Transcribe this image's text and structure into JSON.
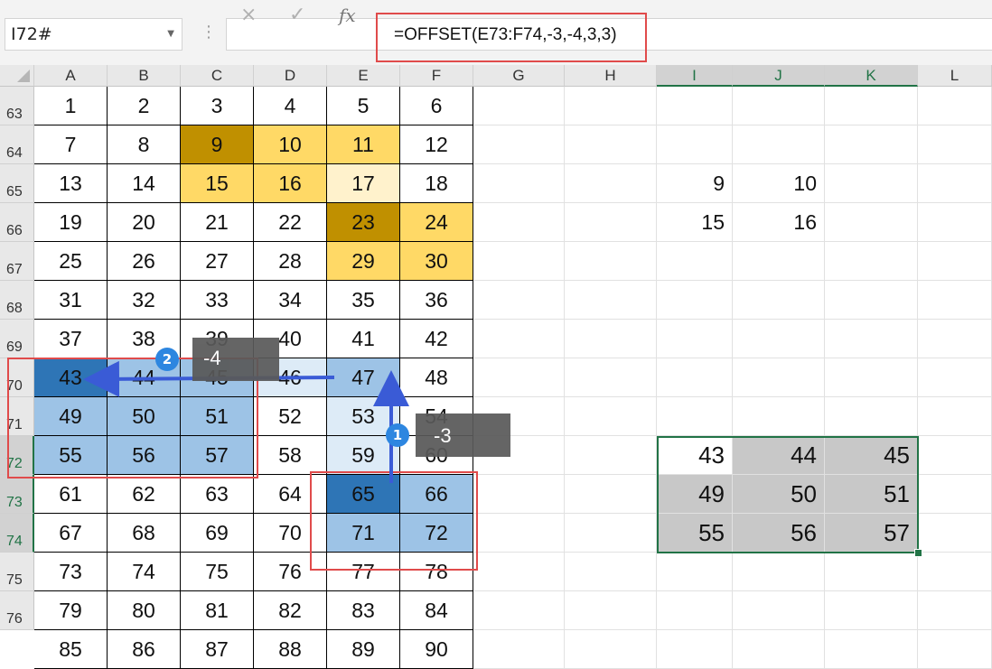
{
  "name_box": "I72#",
  "formula": "=OFFSET(E73:F74,-3,-4,3,3)",
  "toolbar": {
    "cancel_icon": "×",
    "confirm_icon": "✓",
    "fx_icon": "fx"
  },
  "columns": [
    "A",
    "B",
    "C",
    "D",
    "E",
    "F",
    "G",
    "H",
    "I",
    "J",
    "K",
    "L"
  ],
  "rows": [
    "63",
    "64",
    "65",
    "66",
    "67",
    "68",
    "69",
    "70",
    "71",
    "72",
    "73",
    "74",
    "75",
    "76"
  ],
  "grid_values": [
    [
      "1",
      "2",
      "3",
      "4",
      "5",
      "6"
    ],
    [
      "7",
      "8",
      "9",
      "10",
      "11",
      "12"
    ],
    [
      "13",
      "14",
      "15",
      "16",
      "17",
      "18"
    ],
    [
      "19",
      "20",
      "21",
      "22",
      "23",
      "24"
    ],
    [
      "25",
      "26",
      "27",
      "28",
      "29",
      "30"
    ],
    [
      "31",
      "32",
      "33",
      "34",
      "35",
      "36"
    ],
    [
      "37",
      "38",
      "39",
      "40",
      "41",
      "42"
    ],
    [
      "43",
      "44",
      "45",
      "46",
      "47",
      "48"
    ],
    [
      "49",
      "50",
      "51",
      "52",
      "53",
      "54"
    ],
    [
      "55",
      "56",
      "57",
      "58",
      "59",
      "60"
    ],
    [
      "61",
      "62",
      "63",
      "64",
      "65",
      "66"
    ],
    [
      "67",
      "68",
      "69",
      "70",
      "71",
      "72"
    ],
    [
      "73",
      "74",
      "75",
      "76",
      "77",
      "78"
    ],
    [
      "79",
      "80",
      "81",
      "82",
      "83",
      "84"
    ],
    [
      "85",
      "86",
      "87",
      "88",
      "89",
      "90"
    ]
  ],
  "side_values": [
    [
      "9",
      "10"
    ],
    [
      "15",
      "16"
    ]
  ],
  "result_values": [
    [
      "43",
      "44",
      "45"
    ],
    [
      "49",
      "50",
      "51"
    ],
    [
      "55",
      "56",
      "57"
    ]
  ],
  "annotations": {
    "step1": {
      "number": "1",
      "label": "-3"
    },
    "step2": {
      "number": "2",
      "label": "-4"
    }
  },
  "colors": {
    "dark_gold": "#c09000",
    "gold": "#ffd966",
    "light_gold": "#fff2cc",
    "dark_blue": "#2e75b6",
    "mid_blue": "#9dc3e6",
    "light_blue": "#ddebf7",
    "result_gray": "#c8c8c8",
    "red_outline": "#e04b4b",
    "excel_green": "#217346"
  }
}
